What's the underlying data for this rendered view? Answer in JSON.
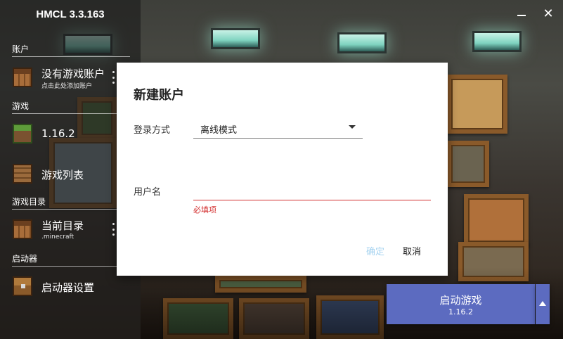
{
  "app": {
    "title": "HMCL 3.3.163"
  },
  "window": {
    "minimize_icon": "minimize-icon",
    "close_label": "✕"
  },
  "sidebar": {
    "sections": {
      "account": "账户",
      "game": "游戏",
      "game_dir": "游戏目录",
      "launcher": "启动器"
    },
    "items": [
      {
        "label": "没有游戏账户",
        "sub": "点击此处添加账户",
        "icon": "crafting-table-icon"
      },
      {
        "label": "1.16.2",
        "icon": "grass-block-icon"
      },
      {
        "label": "游戏列表",
        "icon": "bookshelf-icon"
      },
      {
        "label": "当前目录",
        "sub": ".minecraft",
        "icon": "crafting-table-icon"
      },
      {
        "label": "启动器设置",
        "icon": "chest-icon"
      }
    ]
  },
  "dialog": {
    "title": "新建账户",
    "login_label": "登录方式",
    "login_value": "离线模式",
    "username_label": "用户名",
    "username_value": "",
    "username_error": "必填项",
    "confirm": "确定",
    "cancel": "取消"
  },
  "launch": {
    "label": "启动游戏",
    "version": "1.16.2"
  },
  "colors": {
    "accent": "#5c6bc0",
    "error": "#d32f2f",
    "confirm_disabled": "#a6d3f0"
  }
}
